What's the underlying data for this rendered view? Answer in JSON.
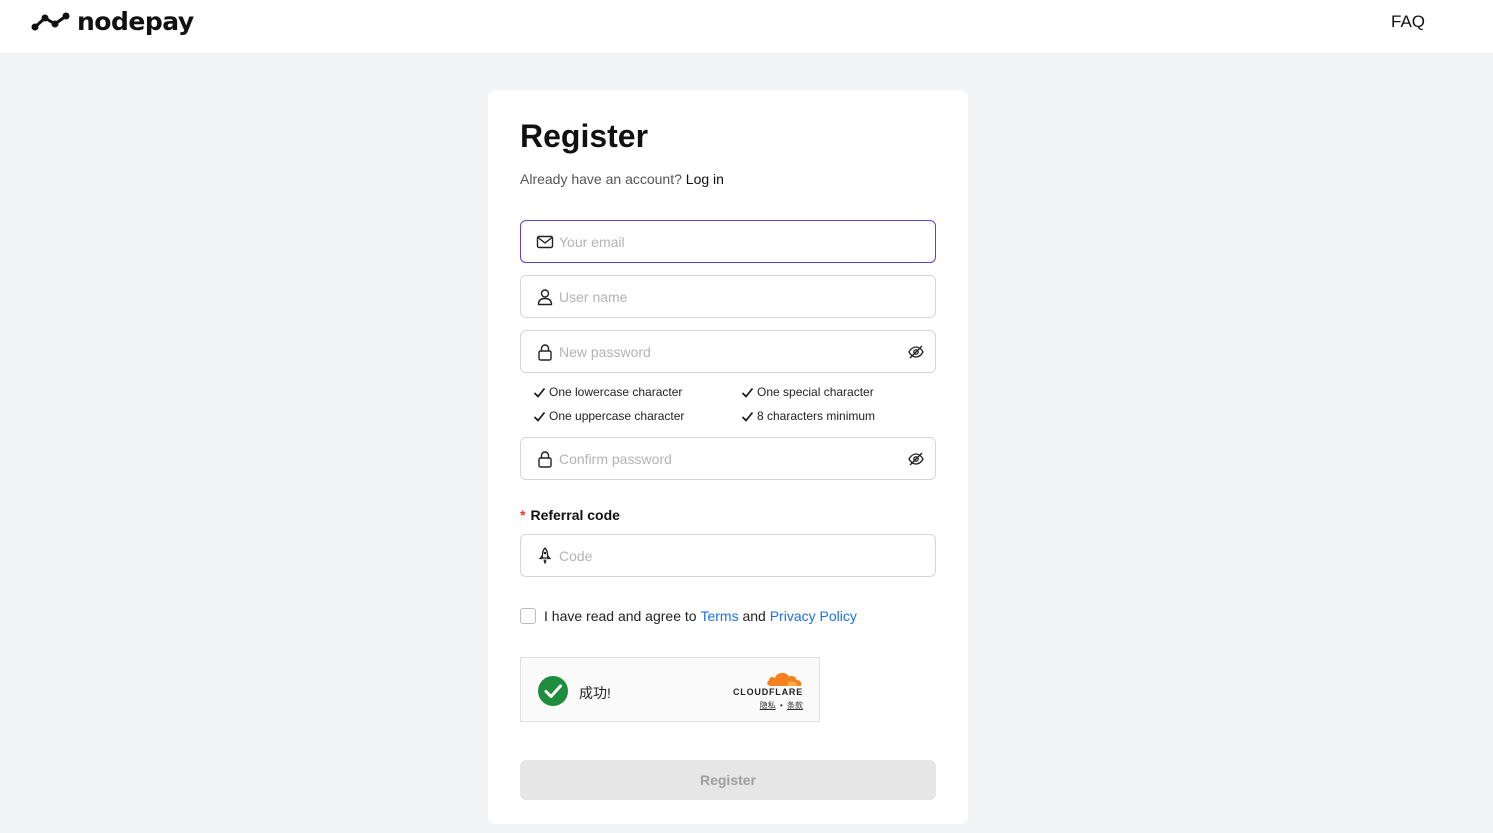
{
  "header": {
    "brand": "nodepay",
    "faq_label": "FAQ"
  },
  "form": {
    "title": "Register",
    "subtitle_prefix": "Already have an account? ",
    "login_link": "Log in",
    "email_placeholder": "Your email",
    "username_placeholder": "User name",
    "password_placeholder": "New password",
    "password_rules": [
      "One lowercase character",
      "One special character",
      "One uppercase character",
      "8 characters minimum"
    ],
    "confirm_placeholder": "Confirm password",
    "referral_required_mark": "*",
    "referral_label": "Referral code",
    "referral_placeholder": "Code",
    "agree_prefix": "I have read and agree to",
    "terms_link": "Terms",
    "agree_and": "and",
    "privacy_link": "Privacy Policy",
    "agree_checked": false,
    "register_label": "Register"
  },
  "captcha": {
    "status": "成功!",
    "brand": "CLOUDFLARE",
    "privacy_link": "隐私",
    "separator": "•",
    "terms_link": "条款"
  },
  "colors": {
    "focus_border": "#5b3fd6",
    "link": "#1a73e8",
    "required": "#e53935",
    "success": "#1e8e3e",
    "cloudflare": "#f48120",
    "page_bg": "#f3f4f6"
  },
  "icons": [
    "nodepay-logo-icon",
    "mail-icon",
    "user-icon",
    "lock-icon",
    "eye-off-icon",
    "check-icon",
    "rocket-icon",
    "success-check-icon",
    "cloudflare-logo-icon"
  ]
}
